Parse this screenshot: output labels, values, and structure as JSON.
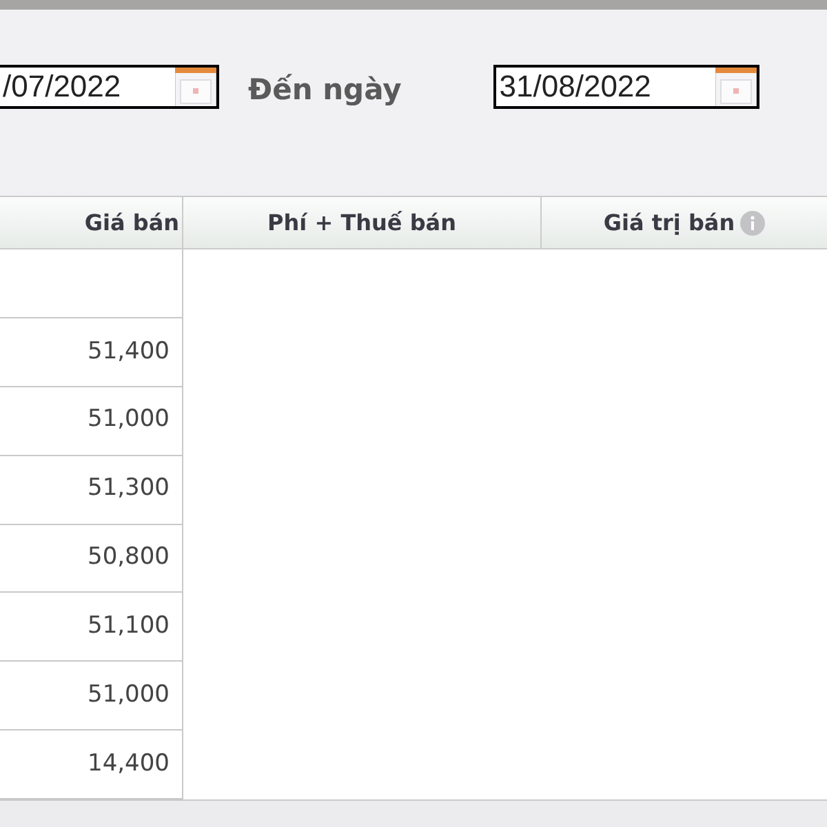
{
  "filter": {
    "from_date": {
      "value": "/07/2022"
    },
    "to_label": "Đến ngày",
    "to_date": {
      "value": "31/08/2022"
    }
  },
  "table": {
    "columns": [
      {
        "label": "Giá bán",
        "info": false
      },
      {
        "label": "Phí + Thuế bán",
        "info": false
      },
      {
        "label": "Giá trị bán",
        "info": true
      }
    ],
    "rows": [
      {
        "gia_ban": "51,400"
      },
      {
        "gia_ban": "51,000"
      },
      {
        "gia_ban": "51,300"
      },
      {
        "gia_ban": "50,800"
      },
      {
        "gia_ban": "51,100"
      },
      {
        "gia_ban": "51,000"
      },
      {
        "gia_ban": "14,400"
      }
    ]
  }
}
